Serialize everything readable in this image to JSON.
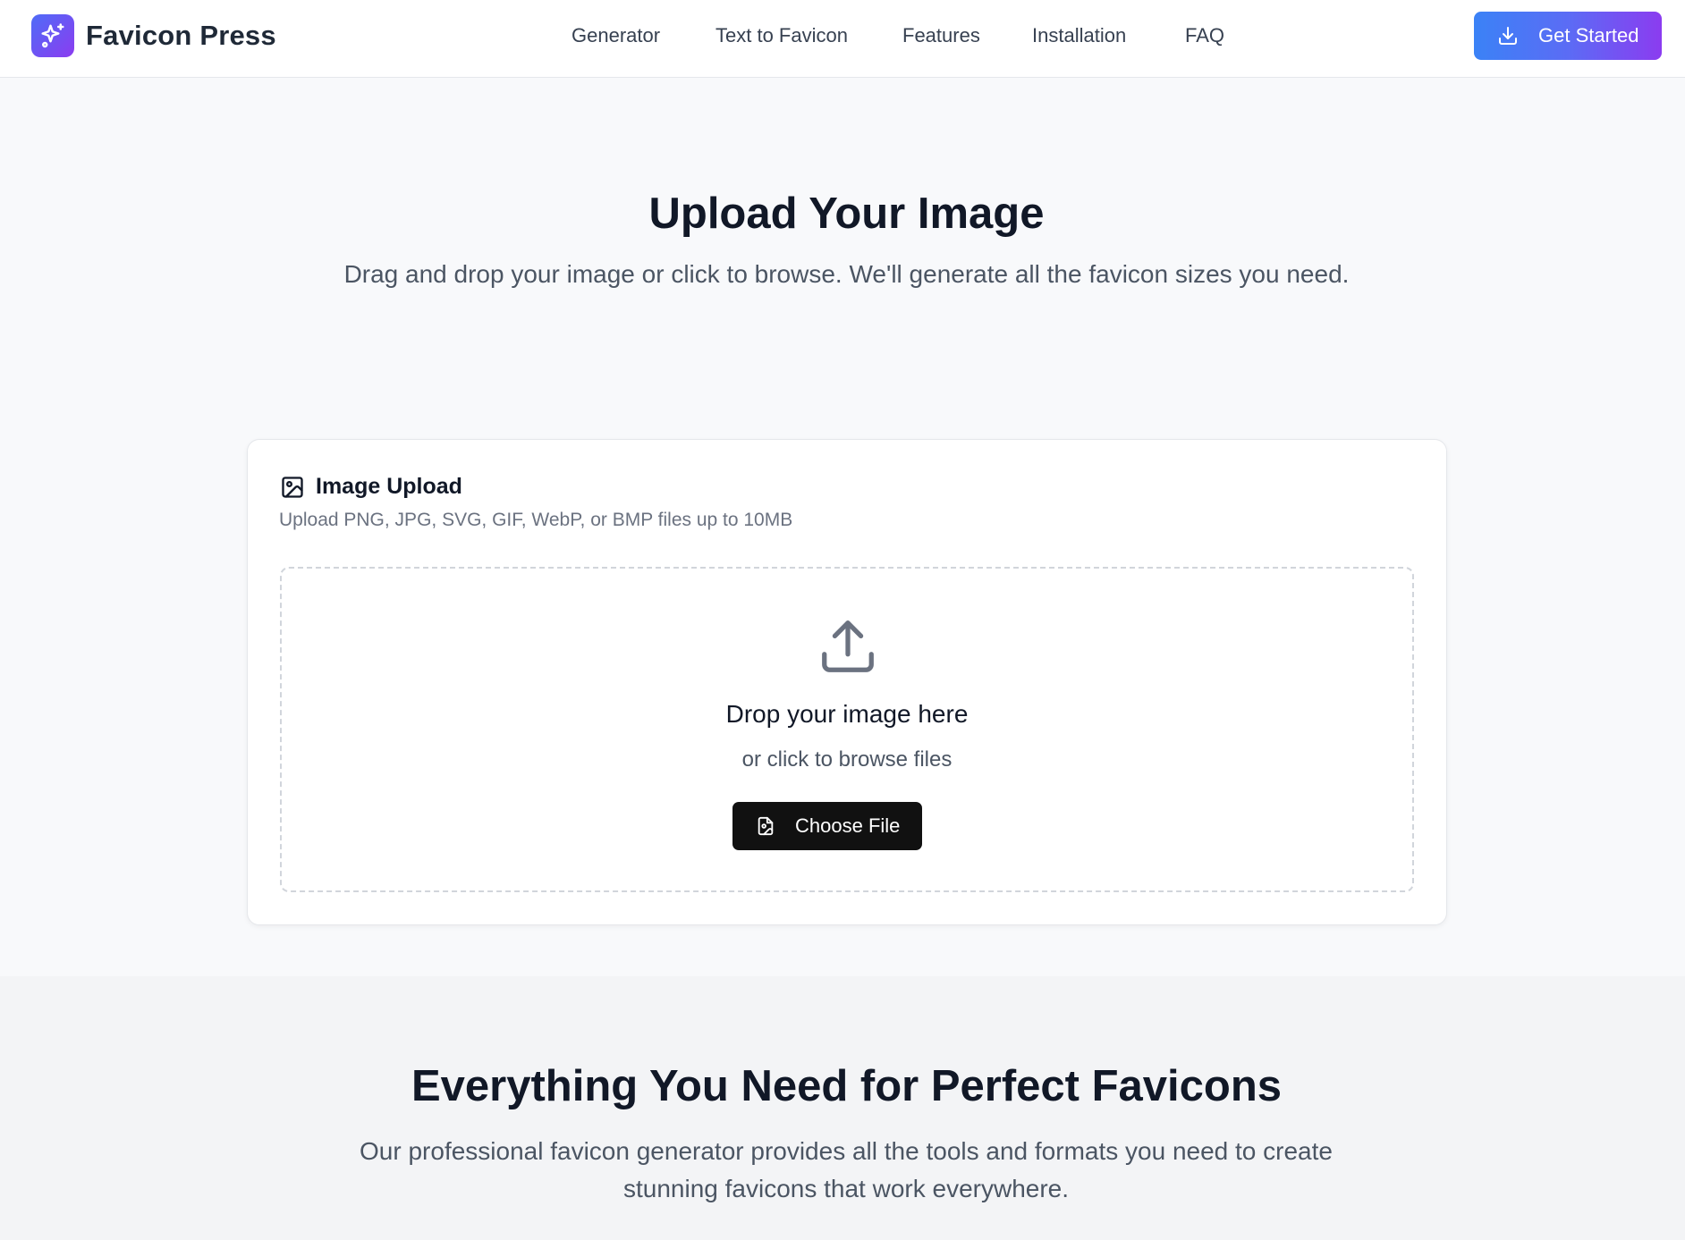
{
  "header": {
    "brand": "Favicon Press",
    "logo_icon": "sparkles-icon",
    "nav": [
      {
        "label": "Generator"
      },
      {
        "label": "Text to Favicon"
      },
      {
        "label": "Features"
      },
      {
        "label": "Installation"
      },
      {
        "label": "FAQ"
      }
    ],
    "cta": {
      "label": "Get Started",
      "icon": "download-icon"
    }
  },
  "hero": {
    "title": "Upload Your Image",
    "subtitle": "Drag and drop your image or click to browse. We'll generate all the favicon sizes you need."
  },
  "upload_card": {
    "title": "Image Upload",
    "title_icon": "image-icon",
    "description": "Upload PNG, JPG, SVG, GIF, WebP, or BMP files up to 10MB",
    "dropzone": {
      "icon": "upload-icon",
      "title": "Drop your image here",
      "subtitle": "or click to browse files",
      "button_label": "Choose File",
      "button_icon": "file-image-icon"
    }
  },
  "features": {
    "title": "Everything You Need for Perfect Favicons",
    "subtitle": "Our professional favicon generator provides all the tools and formats you need to create stunning favicons that work everywhere."
  },
  "colors": {
    "accent_start": "#3b82f6",
    "accent_end": "#8b3cf0",
    "primary_button": "#111111",
    "heading": "#111827",
    "muted": "#4b5563"
  }
}
